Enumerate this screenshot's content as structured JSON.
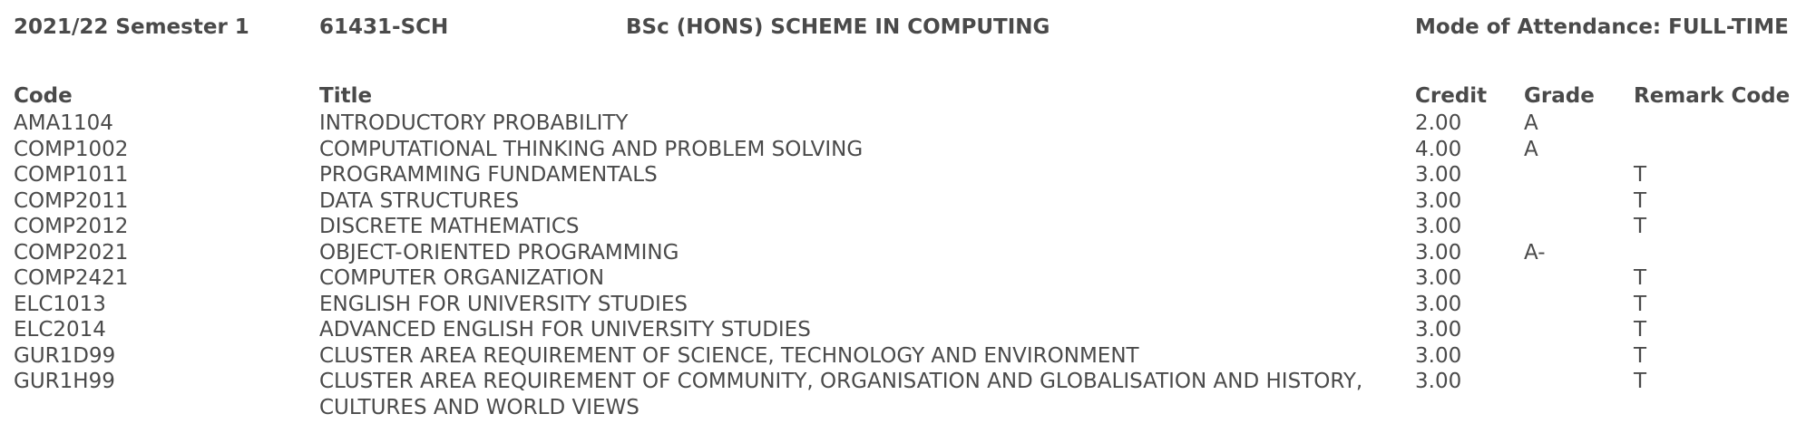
{
  "header": {
    "semester": "2021/22 Semester 1",
    "programme_code": "61431-SCH",
    "programme_name": "BSc (HONS) SCHEME IN COMPUTING",
    "mode_of_attendance": "Mode of Attendance: FULL-TIME"
  },
  "table": {
    "columns": {
      "code": "Code",
      "title": "Title",
      "credit": "Credit",
      "grade": "Grade",
      "remark": "Remark Code"
    },
    "rows": [
      {
        "code": "AMA1104",
        "title": "INTRODUCTORY PROBABILITY",
        "credit": "2.00",
        "grade": "A",
        "remark": ""
      },
      {
        "code": "COMP1002",
        "title": "COMPUTATIONAL THINKING AND PROBLEM SOLVING",
        "credit": "4.00",
        "grade": "A",
        "remark": ""
      },
      {
        "code": "COMP1011",
        "title": "PROGRAMMING FUNDAMENTALS",
        "credit": "3.00",
        "grade": "",
        "remark": "T"
      },
      {
        "code": "COMP2011",
        "title": "DATA STRUCTURES",
        "credit": "3.00",
        "grade": "",
        "remark": "T"
      },
      {
        "code": "COMP2012",
        "title": "DISCRETE MATHEMATICS",
        "credit": "3.00",
        "grade": "",
        "remark": "T"
      },
      {
        "code": "COMP2021",
        "title": "OBJECT-ORIENTED PROGRAMMING",
        "credit": "3.00",
        "grade": "A-",
        "remark": ""
      },
      {
        "code": "COMP2421",
        "title": "COMPUTER ORGANIZATION",
        "credit": "3.00",
        "grade": "",
        "remark": "T"
      },
      {
        "code": "ELC1013",
        "title": "ENGLISH FOR UNIVERSITY STUDIES",
        "credit": "3.00",
        "grade": "",
        "remark": "T"
      },
      {
        "code": "ELC2014",
        "title": "ADVANCED ENGLISH FOR UNIVERSITY STUDIES",
        "credit": "3.00",
        "grade": "",
        "remark": "T"
      },
      {
        "code": "GUR1D99",
        "title": "CLUSTER AREA REQUIREMENT OF SCIENCE, TECHNOLOGY AND ENVIRONMENT",
        "credit": "3.00",
        "grade": "",
        "remark": "T"
      },
      {
        "code": "GUR1H99",
        "title": "CLUSTER AREA REQUIREMENT OF COMMUNITY, ORGANISATION AND GLOBALISATION AND HISTORY, CULTURES AND WORLD VIEWS",
        "credit": "3.00",
        "grade": "",
        "remark": "T"
      }
    ]
  }
}
